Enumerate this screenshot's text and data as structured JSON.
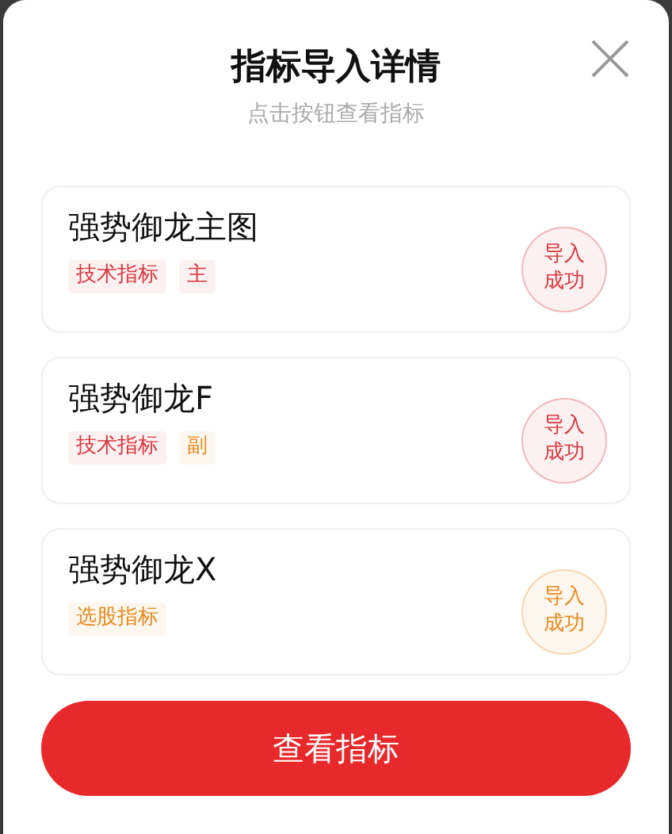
{
  "dialog": {
    "title": "指标导入详情",
    "subtitle": "点击按钮查看指标"
  },
  "items": [
    {
      "name": "强势御龙主图",
      "tags": [
        {
          "label": "技术指标",
          "color": "#d9363e"
        },
        {
          "label": "主",
          "color": "#d9363e"
        }
      ],
      "stamp": {
        "label": "导入成功",
        "color": "#d9363e"
      }
    },
    {
      "name": "强势御龙F",
      "tags": [
        {
          "label": "技术指标",
          "color": "#d9363e"
        },
        {
          "label": "副",
          "color": "#e8891c"
        }
      ],
      "stamp": {
        "label": "导入成功",
        "color": "#d9363e"
      }
    },
    {
      "name": "强势御龙X",
      "tags": [
        {
          "label": "选股指标",
          "color": "#e8891c"
        }
      ],
      "stamp": {
        "label": "导入成功",
        "color": "#e8891c"
      }
    }
  ],
  "button": {
    "label": "查看指标"
  }
}
